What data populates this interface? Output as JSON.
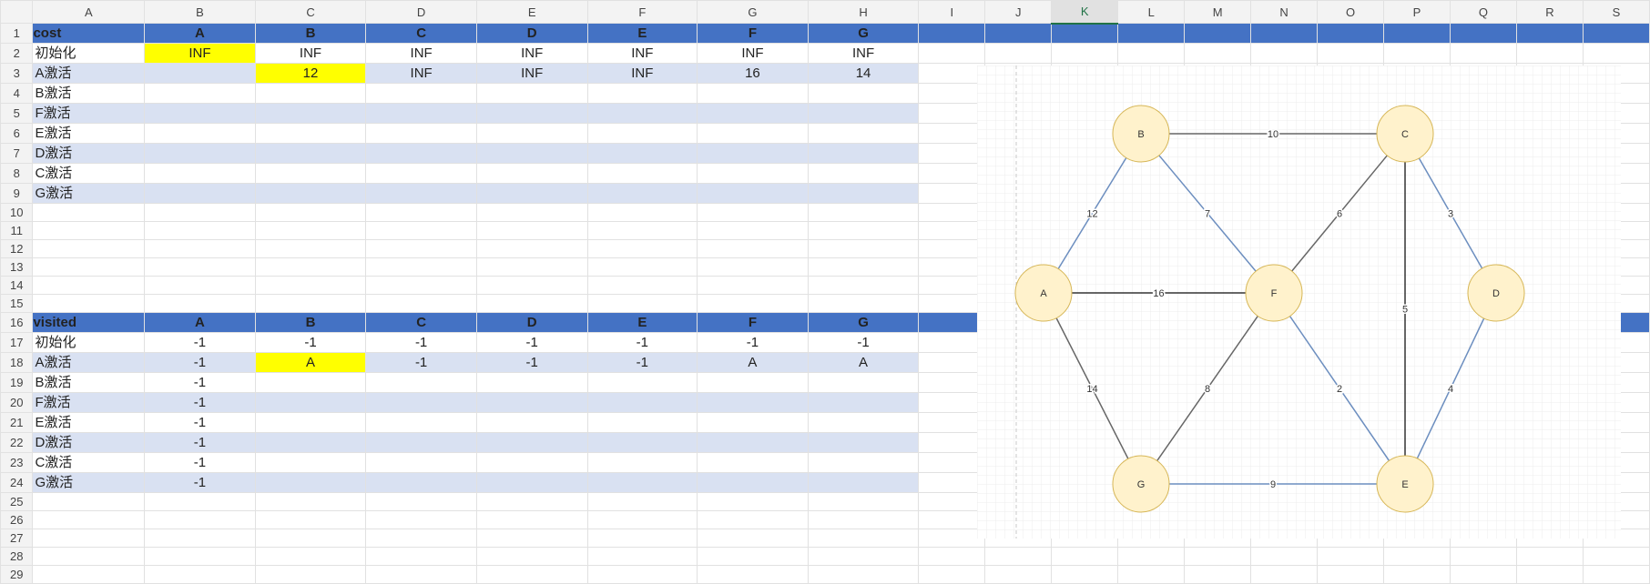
{
  "columns": [
    "A",
    "B",
    "C",
    "D",
    "E",
    "F",
    "G",
    "H",
    "I",
    "J",
    "K",
    "L",
    "M",
    "N",
    "O",
    "P",
    "Q",
    "R",
    "S"
  ],
  "selected_column": "K",
  "rows": [
    {
      "n": "1",
      "type": "hdr",
      "cells": [
        "cost",
        "A",
        "B",
        "C",
        "D",
        "E",
        "F",
        "G"
      ]
    },
    {
      "n": "2",
      "type": "plain",
      "cells": [
        "初始化",
        "INF",
        "INF",
        "INF",
        "INF",
        "INF",
        "INF",
        "INF"
      ],
      "yellow": [
        1
      ]
    },
    {
      "n": "3",
      "type": "band",
      "cells": [
        "A激活",
        "",
        "12",
        "INF",
        "INF",
        "INF",
        "16",
        "14"
      ],
      "yellow": [
        2
      ]
    },
    {
      "n": "4",
      "type": "plain",
      "cells": [
        "B激活",
        "",
        "",
        "",
        "",
        "",
        "",
        ""
      ]
    },
    {
      "n": "5",
      "type": "band",
      "cells": [
        "F激活",
        "",
        "",
        "",
        "",
        "",
        "",
        ""
      ]
    },
    {
      "n": "6",
      "type": "plain",
      "cells": [
        "E激活",
        "",
        "",
        "",
        "",
        "",
        "",
        ""
      ]
    },
    {
      "n": "7",
      "type": "band",
      "cells": [
        "D激活",
        "",
        "",
        "",
        "",
        "",
        "",
        ""
      ]
    },
    {
      "n": "8",
      "type": "plain",
      "cells": [
        "C激活",
        "",
        "",
        "",
        "",
        "",
        "",
        ""
      ]
    },
    {
      "n": "9",
      "type": "band",
      "cells": [
        "G激活",
        "",
        "",
        "",
        "",
        "",
        "",
        ""
      ]
    },
    {
      "n": "10",
      "type": "empty"
    },
    {
      "n": "11",
      "type": "empty"
    },
    {
      "n": "12",
      "type": "empty"
    },
    {
      "n": "13",
      "type": "empty"
    },
    {
      "n": "14",
      "type": "empty"
    },
    {
      "n": "15",
      "type": "empty"
    },
    {
      "n": "16",
      "type": "hdr",
      "cells": [
        "visited",
        "A",
        "B",
        "C",
        "D",
        "E",
        "F",
        "G"
      ]
    },
    {
      "n": "17",
      "type": "plain",
      "cells": [
        "初始化",
        "-1",
        "-1",
        "-1",
        "-1",
        "-1",
        "-1",
        "-1"
      ]
    },
    {
      "n": "18",
      "type": "band",
      "cells": [
        "A激活",
        "-1",
        "A",
        "-1",
        "-1",
        "-1",
        "A",
        "A"
      ],
      "yellow": [
        2
      ]
    },
    {
      "n": "19",
      "type": "plain",
      "cells": [
        "B激活",
        "-1",
        "",
        "",
        "",
        "",
        "",
        ""
      ]
    },
    {
      "n": "20",
      "type": "band",
      "cells": [
        "F激活",
        "-1",
        "",
        "",
        "",
        "",
        "",
        ""
      ]
    },
    {
      "n": "21",
      "type": "plain",
      "cells": [
        "E激活",
        "-1",
        "",
        "",
        "",
        "",
        "",
        ""
      ]
    },
    {
      "n": "22",
      "type": "band",
      "cells": [
        "D激活",
        "-1",
        "",
        "",
        "",
        "",
        "",
        ""
      ]
    },
    {
      "n": "23",
      "type": "plain",
      "cells": [
        "C激活",
        "-1",
        "",
        "",
        "",
        "",
        "",
        ""
      ]
    },
    {
      "n": "24",
      "type": "band",
      "cells": [
        "G激活",
        "-1",
        "",
        "",
        "",
        "",
        "",
        ""
      ]
    },
    {
      "n": "25",
      "type": "empty"
    },
    {
      "n": "26",
      "type": "empty"
    },
    {
      "n": "27",
      "type": "empty"
    },
    {
      "n": "28",
      "type": "empty"
    },
    {
      "n": "29",
      "type": "empty"
    }
  ],
  "graph": {
    "node_fill": "#fff2cc",
    "node_stroke": "#d6b656",
    "nodes": [
      "A",
      "B",
      "C",
      "D",
      "E",
      "F",
      "G"
    ],
    "edges": [
      {
        "from": "B",
        "to": "C",
        "weight": "10",
        "color": "#666666"
      },
      {
        "from": "A",
        "to": "B",
        "weight": "12",
        "color": "#6c8ebf"
      },
      {
        "from": "B",
        "to": "F",
        "weight": "7",
        "color": "#6c8ebf"
      },
      {
        "from": "C",
        "to": "F",
        "weight": "6",
        "color": "#666666"
      },
      {
        "from": "C",
        "to": "D",
        "weight": "3",
        "color": "#6c8ebf"
      },
      {
        "from": "C",
        "to": "E",
        "weight": "5",
        "color": "#333333"
      },
      {
        "from": "A",
        "to": "F",
        "weight": "16",
        "color": "#333333"
      },
      {
        "from": "A",
        "to": "G",
        "weight": "14",
        "color": "#666666"
      },
      {
        "from": "F",
        "to": "G",
        "weight": "8",
        "color": "#666666"
      },
      {
        "from": "F",
        "to": "E",
        "weight": "2",
        "color": "#6c8ebf"
      },
      {
        "from": "D",
        "to": "E",
        "weight": "4",
        "color": "#6c8ebf"
      },
      {
        "from": "G",
        "to": "E",
        "weight": "9",
        "color": "#6c8ebf"
      }
    ]
  }
}
